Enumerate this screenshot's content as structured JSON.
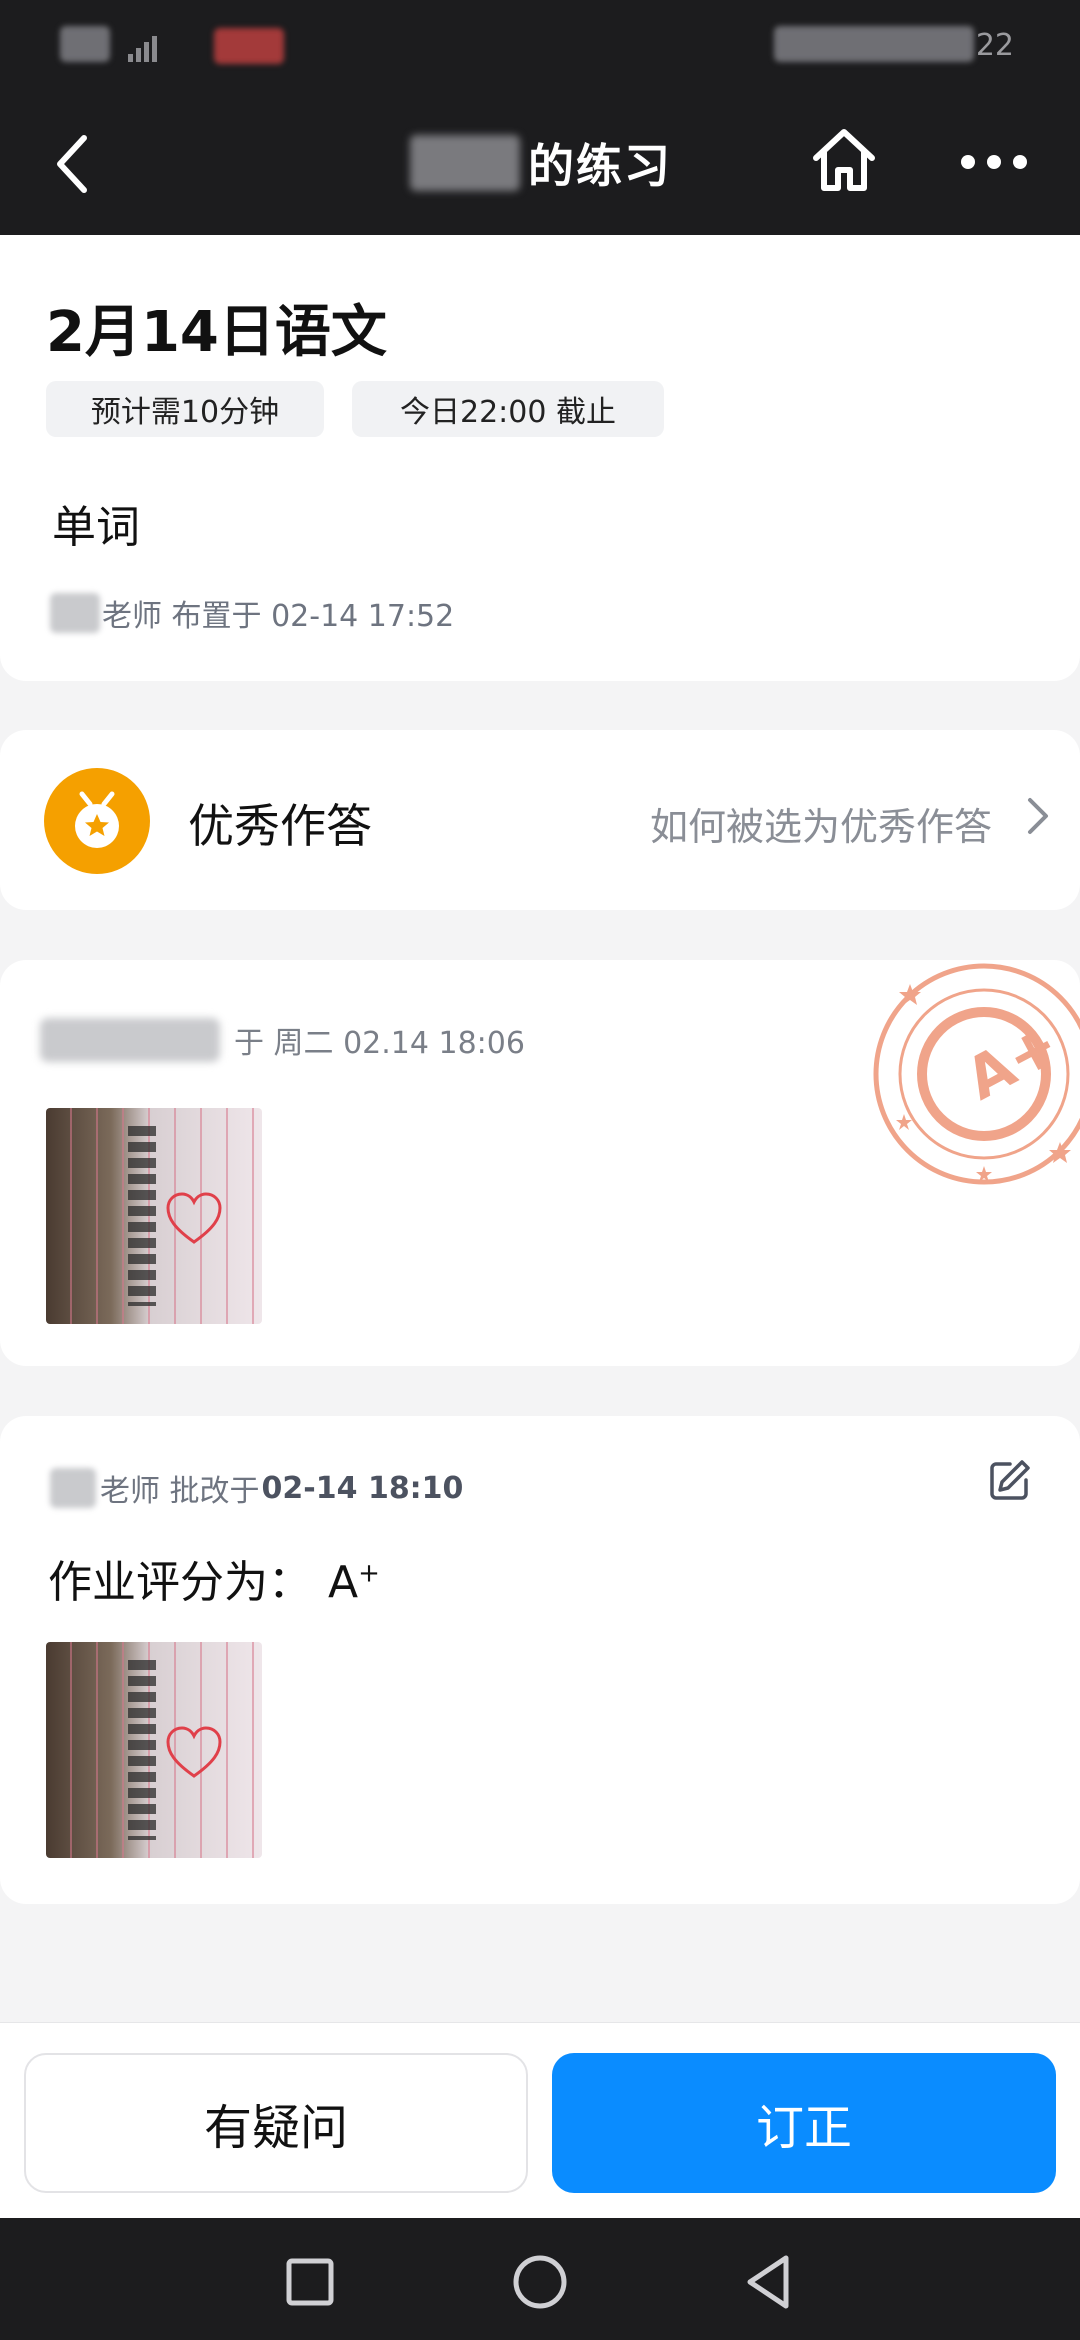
{
  "status_bar": {
    "time": "22"
  },
  "nav": {
    "title": "的练习"
  },
  "homework": {
    "title": "2月14日语文",
    "tags": {
      "duration": "预计需10分钟",
      "deadline": "今日22:00 截止"
    },
    "content": "单词",
    "assigned_by": "老师 布置于 02-14 17:52"
  },
  "excellent": {
    "label": "优秀作答",
    "link": "如何被选为优秀作答"
  },
  "submission": {
    "submitted": "于 周二 02.14 18:06",
    "stamp_grade": "A+"
  },
  "review": {
    "reviewer": "老师 批改于",
    "time": "02-14 18:10",
    "grade_label": "作业评分为：",
    "grade_letter": "A",
    "grade_sup": "+"
  },
  "actions": {
    "question": "有疑问",
    "correct": "订正"
  },
  "colors": {
    "header_bg": "#1c1c1e",
    "accent_blue": "#0a8cff",
    "medal_orange": "#f5a000",
    "stamp_pink": "#f0a48a"
  }
}
